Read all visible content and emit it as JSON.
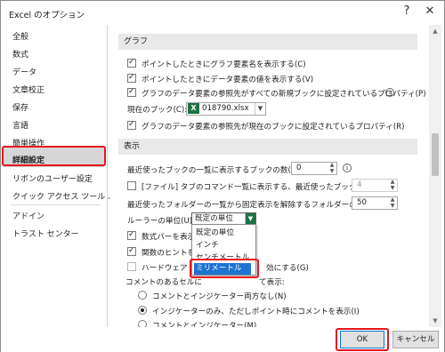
{
  "window": {
    "title": "Excel のオプション",
    "help_glyph": "?",
    "close_glyph": "✕"
  },
  "sidebar": {
    "items": [
      {
        "label": "全般"
      },
      {
        "label": "数式"
      },
      {
        "label": "データ"
      },
      {
        "label": "文章校正"
      },
      {
        "label": "保存"
      },
      {
        "label": "言語"
      },
      {
        "label": "簡単操作"
      },
      {
        "label": "詳細設定"
      },
      {
        "label": "リボンのユーザー設定"
      },
      {
        "label": "クイック アクセス ツール バー"
      },
      {
        "label": "アドイン"
      },
      {
        "label": "トラスト センター"
      }
    ],
    "selected": "詳細設定"
  },
  "sections": {
    "graph": {
      "header": "グラフ",
      "show_element_names": "ポイントしたときにグラフ要素名を表示する(C)",
      "show_data_values": "ポイントしたときにデータ要素の値を表示する(V)",
      "props_all_new": "グラフのデータ要素の参照先がすべての新規ブックに設定されているプロパティ(P)",
      "current_book_label": "現在のブック(C):",
      "current_book_value": "018790.xlsx",
      "props_current": "グラフのデータ要素の参照先が現在のブックに設定されているプロパティ(R)"
    },
    "display": {
      "header": "表示",
      "recent_books_label": "最近使ったブックの一覧に表示するブックの数(R):",
      "recent_books_value": "0",
      "quick_access_label": "[ファイル] タブのコマンド一覧に表示する、最近使ったブックの数(Q):",
      "quick_access_value": "4",
      "unpinned_folders_label": "最近使ったフォルダーの一覧から固定表示を解除するフォルダーの数(F):",
      "unpinned_folders_value": "50",
      "ruler_units_label": "ルーラーの単位(U)",
      "ruler_units_value": "既定の単位",
      "formula_bar_partial": "数式バーを表示す",
      "function_hints_partial": "関数のヒントを表",
      "hw_accel_partial_a": "ハードウェア グラ",
      "hw_accel_partial_b": "効にする(G)",
      "comments_label_partial": "コメントのあるセルに",
      "comments_label_tail": "て表示:",
      "radio_none": "コメントとインジケーター両方なし(N)",
      "radio_indicator": "インジケーターのみ、ただしポイント時にコメントを表示(I)",
      "radio_both": "コメントとインジケーター(M)"
    }
  },
  "ruler_dropdown": {
    "options": [
      "既定の単位",
      "インチ",
      "センチメートル",
      "ミリメートル"
    ],
    "highlighted": "ミリメートル"
  },
  "footer": {
    "ok": "OK",
    "cancel": "キャンセル"
  },
  "colors": {
    "accent": "#1e73d2",
    "highlight_red": "#e8141e",
    "excel_green": "#1f7244"
  },
  "icons": {
    "info": "info-icon",
    "excel_file": "excel-file-icon",
    "dropdown": "chevron-down-icon"
  }
}
